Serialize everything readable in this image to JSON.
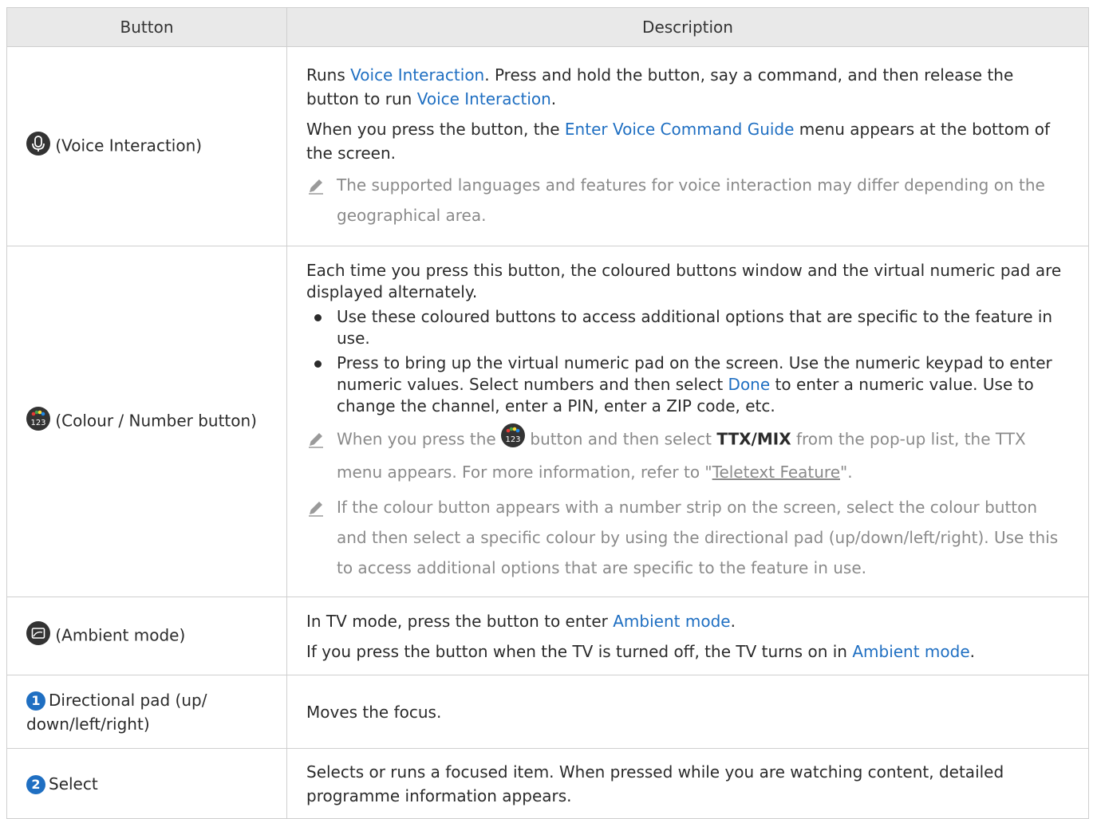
{
  "header": {
    "col_button": "Button",
    "col_description": "Description"
  },
  "rows": [
    {
      "button": "(Voice Interaction)",
      "icon": "microphone-icon",
      "para1": [
        "Runs ",
        "Voice Interaction",
        ". Press and hold the button, say a command, and then release the button to run ",
        "Voice Interaction",
        "."
      ],
      "para2": [
        "When you press the button, the ",
        "Enter Voice Command Guide",
        " menu appears at the bottom of the screen."
      ],
      "note": "The supported languages and features for voice interaction may differ depending on the geographical area."
    },
    {
      "button": "(Colour / Number button)",
      "icon": "colour-number-icon",
      "icon_text": "123",
      "para1": "Each time you press this button, the coloured buttons window and the virtual numeric pad are displayed alternately.",
      "bullet1": "Use these coloured buttons to access additional options that are specific to the feature in use.",
      "bullet2": [
        "Press to bring up the virtual numeric pad on the screen. Use the numeric keypad to enter numeric values. Select numbers and then select ",
        "Done",
        " to enter a numeric value. Use to change the channel, enter a PIN, enter a ZIP code, etc."
      ],
      "note1": [
        "When you press the ",
        " button and then select ",
        "TTX/MIX",
        " from the pop-up list, the TTX menu appears. For more information, refer to \"",
        "Teletext Feature",
        "\"."
      ],
      "note2": "If the colour button appears with a number strip on the screen, select the colour button and then select a specific colour by using the directional pad (up/down/left/right). Use this to access additional options that are specific to the feature in use."
    },
    {
      "button": "(Ambient mode)",
      "icon": "ambient-mode-icon",
      "para1": [
        "In TV mode, press the button to enter ",
        "Ambient mode",
        "."
      ],
      "para2": [
        "If you press the button when the TV is turned off, the TV turns on in ",
        "Ambient mode",
        "."
      ]
    },
    {
      "badge": "1",
      "button": "Directional pad (up/ down/left/right)",
      "desc": "Moves the focus."
    },
    {
      "badge": "2",
      "button": "Select",
      "desc": "Selects or runs a focused item. When pressed while you are watching content, detailed programme information appears."
    }
  ],
  "colors": {
    "link": "#1f6fc2",
    "note": "#8a8a8a",
    "header_bg": "#e9e9e9",
    "border": "#cfcfcf"
  }
}
